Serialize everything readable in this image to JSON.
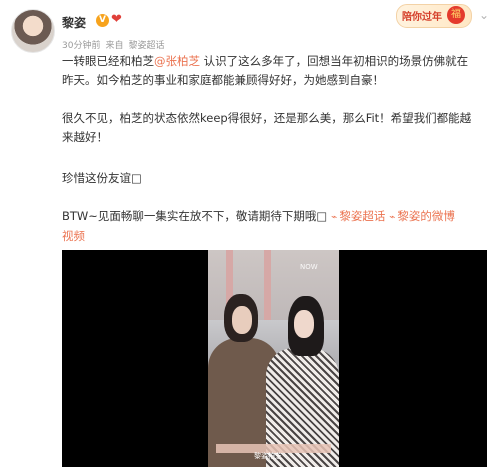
{
  "author": {
    "name": "黎姿",
    "verified_mark": "V",
    "heart": "❤"
  },
  "meta": {
    "time": "30分钟前",
    "from_label": "来自",
    "source": "黎姿超话"
  },
  "badge": {
    "text": "陪你过年"
  },
  "icons": [
    "verified-icon",
    "heart-icon",
    "chevron-down-icon",
    "link-icon",
    "play-icon"
  ],
  "post": {
    "p1_line1_a": "一转眼已经和柏芝",
    "p1_mention": "@张柏芝",
    "p1_line1_b": " 认识了这么多年了，回想当年初相识的场景仿佛就在",
    "p1_line2": "昨天。如今柏芝的事业和家庭都能兼顾得好好，为她感到自豪！",
    "p2_line1": "很久不见，柏芝的状态依然keep得很好，还是那么美，那么Fit！希望我们都能越",
    "p2_line2": "来越好！",
    "p3": "珍惜这份友谊□",
    "p4_text": "BTW~见面畅聊一集实在放不下，敬请期待下期哦□",
    "p4_link1": "黎姿超话",
    "p4_link2": "黎姿的微博",
    "p4_link3": "视频"
  },
  "video": {
    "logo": "NOW",
    "caption": "黎姿柏芝"
  },
  "colors": {
    "link": "#eb7350",
    "badge_text": "#d5402b",
    "meta": "#999999"
  }
}
